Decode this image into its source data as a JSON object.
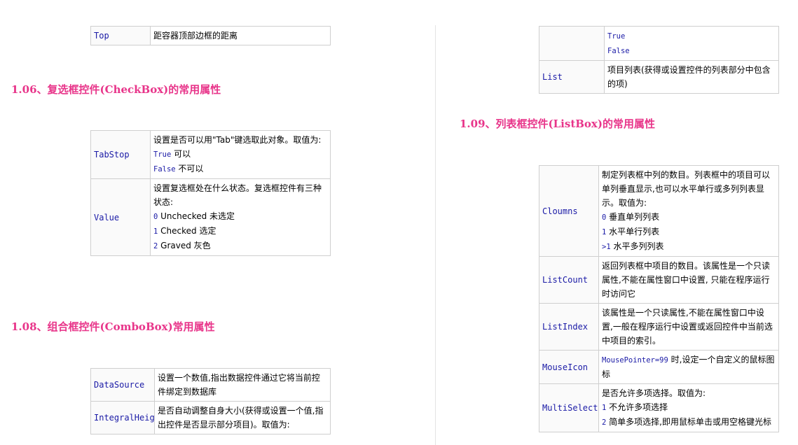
{
  "top_table": {
    "rows": [
      {
        "name": "Top",
        "lines": [
          "距容器顶部边框的距离"
        ]
      }
    ]
  },
  "checkbox": {
    "heading": "1.06、复选框控件(CheckBox)的常用属性",
    "rows": [
      {
        "name": "TabStop",
        "lines": [
          "设置是否可以用\"Tab\"键选取此对象。取值为:",
          "True 可以",
          "False 不可以"
        ]
      },
      {
        "name": "Value",
        "lines": [
          "设置复选框处在什么状态。复选框控件有三种",
          "状态:",
          "0 Unchecked 未选定",
          "1 Checked 选定",
          "2 Graved 灰色"
        ]
      }
    ]
  },
  "combobox": {
    "heading": "1.08、组合框控件(ComboBox)常用属性",
    "rows": [
      {
        "name": "DataSource",
        "lines": [
          "设置一个数值,指出数据控件通过它将当前控",
          "件绑定到数据库"
        ]
      },
      {
        "name": "IntegralHeight",
        "lines": [
          "是否自动调整自身大小(获得或设置一个值,指",
          "出控件是否显示部分项目)。取值为:"
        ]
      }
    ]
  },
  "right_top_table": {
    "rows": [
      {
        "name": "",
        "lines": [
          "True",
          "False"
        ]
      },
      {
        "name": "List",
        "lines": [
          "项目列表(获得或设置控件的列表部分中包含",
          "的项)"
        ]
      }
    ]
  },
  "listbox": {
    "heading": "1.09、列表框控件(ListBox)的常用属性",
    "rows": [
      {
        "name": "Cloumns",
        "lines": [
          "制定列表框中列的数目。列表框中的项目可以",
          "单列垂直显示,也可以水平单行或多列列表显",
          "示。取值为:",
          "0 垂直单列列表",
          "1 水平单行列表",
          ">1 水平多列列表"
        ]
      },
      {
        "name": "ListCount",
        "lines": [
          "返回列表框中项目的数目。该属性是一个只读",
          "属性,不能在属性窗口中设置, 只能在程序运行",
          "时访问它"
        ]
      },
      {
        "name": "ListIndex",
        "lines": [
          "该属性是一个只读属性,不能在属性窗口中设",
          "置,一般在程序运行中设置或返回控件中当前选",
          "中项目的索引。"
        ]
      },
      {
        "name": "MouseIcon",
        "lines": [
          "MousePointer=99 时,设定一个自定义的鼠标图",
          "标"
        ]
      },
      {
        "name": "MultiSelect",
        "lines": [
          "是否允许多项选择。取值为:",
          "1 不允许多项选择",
          "2 简单多项选择,即用鼠标单击或用空格键光标"
        ]
      }
    ]
  }
}
